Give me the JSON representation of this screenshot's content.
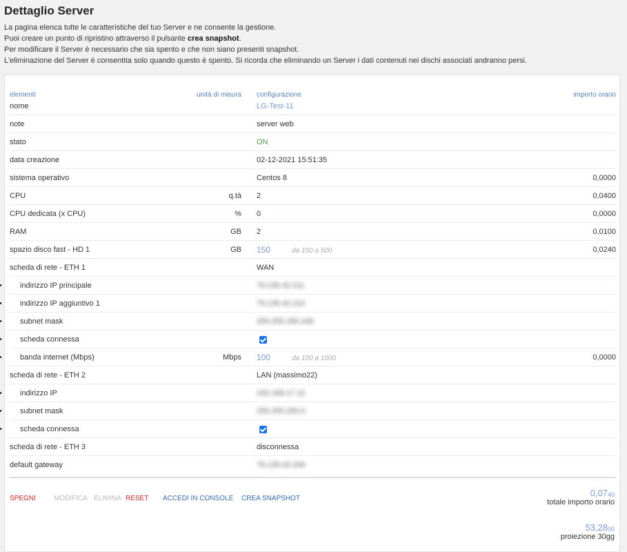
{
  "header": {
    "title": "Dettaglio Server",
    "line1": "La pagina elenca tutte le caratteristiche del tuo Server e ne consente la gestione.",
    "line2_pre": "Puoi creare un punto di ripristino attraverso il pulsante ",
    "line2_bold": "crea snapshot",
    "line2_post": ".",
    "line3": "Per modificare il Server è necessario che sia spento e che non siano presenti snapshot.",
    "line4": "L'eliminazione del Server è consentita solo quando questo è spento. Si ricorda che eliminando un Server i dati contenuti nei dischi associati andranno persi."
  },
  "columns": {
    "elementi": "elementi",
    "unita": "unità di misura",
    "configurazione": "configurazione",
    "importo": "importo orario"
  },
  "rows": {
    "nome": {
      "label": "nome",
      "value": "LG-Test-11"
    },
    "note": {
      "label": "note",
      "value": "server web"
    },
    "stato": {
      "label": "stato",
      "value": "ON"
    },
    "data": {
      "label": "data creazione",
      "value": "02-12-2021 15:51:35"
    },
    "so": {
      "label": "sistema operativo",
      "value": "Centos 8",
      "amount": "0,0000"
    },
    "cpu": {
      "label": "CPU",
      "unit": "q.tà",
      "value": "2",
      "amount": "0,0400"
    },
    "cpu_ded": {
      "label": "CPU dedicata (x CPU)",
      "unit": "%",
      "value": "0",
      "amount": "0,0000"
    },
    "ram": {
      "label": "RAM",
      "unit": "GB",
      "value": "2",
      "amount": "0,0100"
    },
    "disk": {
      "label": "spazio disco fast - HD 1",
      "unit": "GB",
      "value": "150",
      "hint": "da 150 a 500",
      "amount": "0,0240"
    },
    "eth1": {
      "label": "scheda di rete - ETH 1",
      "value": "WAN"
    },
    "eth1_ip": {
      "label": "indirizzo IP principale",
      "value": "79.135.42.211"
    },
    "eth1_ip2": {
      "label": "indirizzo IP aggiuntivo 1",
      "value": "79.135.42.212"
    },
    "eth1_mask": {
      "label": "subnet mask",
      "value": "255.255.255.248"
    },
    "eth1_conn": {
      "label": "scheda connessa",
      "checked": true
    },
    "eth1_band": {
      "label": "banda internet (Mbps)",
      "unit": "Mbps",
      "value": "100",
      "hint": "da 100 a 1000",
      "amount": "0,0000"
    },
    "eth2": {
      "label": "scheda di rete - ETH 2",
      "value": "LAN (massimo22)"
    },
    "eth2_ip": {
      "label": "indirizzo IP",
      "value": "192.168.17.12"
    },
    "eth2_mask": {
      "label": "subnet mask",
      "value": "255.255.255.0"
    },
    "eth2_conn": {
      "label": "scheda connessa",
      "checked": true
    },
    "eth3": {
      "label": "scheda di rete - ETH 3",
      "value": "disconnessa"
    },
    "gateway": {
      "label": "default gateway",
      "value": "79.135.42.209"
    }
  },
  "actions": {
    "spegni": "SPEGNI",
    "modifica": "MODIFICA",
    "elimina": "ELIMINA",
    "reset": "RESET",
    "console": "ACCEDI IN CONSOLE",
    "snapshot": "CREA SNAPSHOT"
  },
  "totals": {
    "hourly_main": "0,07",
    "hourly_dec": "40",
    "hourly_label": "totale importo orario",
    "month_main": "53,28",
    "month_dec": "00",
    "month_label": "proiezione 30gg"
  },
  "colors": {
    "accent_blue": "#7a9ad0",
    "header_blue": "#5a7fb8",
    "danger_red": "#c0282d",
    "status_green": "#5a9a5a",
    "checkbox_blue": "#1a73e8"
  }
}
